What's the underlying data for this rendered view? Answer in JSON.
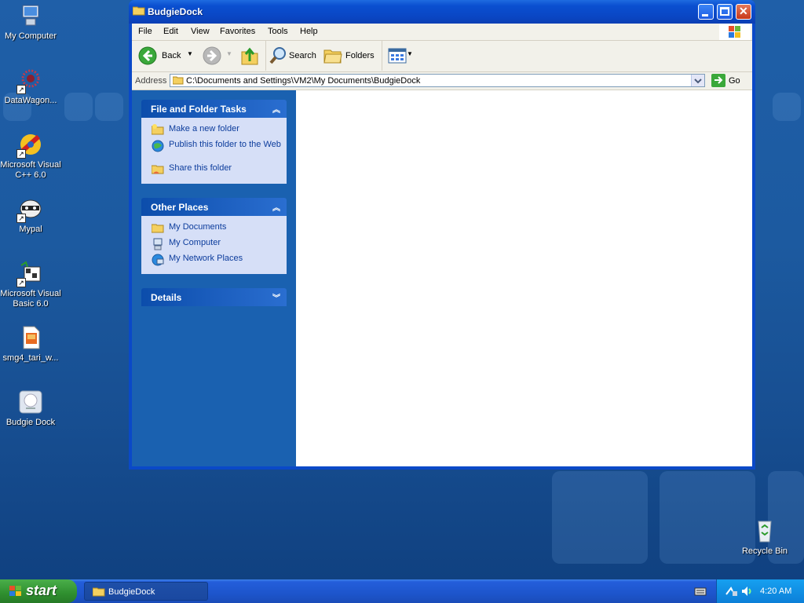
{
  "desktop": {
    "icons": [
      {
        "label": "My Computer"
      },
      {
        "label": "DataWagon..."
      },
      {
        "label": "Microsoft Visual C++ 6.0"
      },
      {
        "label": "Mypal"
      },
      {
        "label": "Microsoft Visual Basic 6.0"
      },
      {
        "label": "smg4_tari_w..."
      },
      {
        "label": "Budgie Dock"
      },
      {
        "label": "Recycle Bin"
      }
    ]
  },
  "window": {
    "title": "BudgieDock",
    "menu": [
      "File",
      "Edit",
      "View",
      "Favorites",
      "Tools",
      "Help"
    ],
    "toolbar": {
      "back": "Back",
      "search": "Search",
      "folders": "Folders"
    },
    "address": {
      "label": "Address",
      "value": "C:\\Documents and Settings\\VM2\\My Documents\\BudgieDock",
      "go": "Go"
    },
    "tasks": {
      "title": "File and Folder Tasks",
      "items": [
        "Make a new folder",
        "Publish this folder to the Web",
        "Share this folder"
      ]
    },
    "places": {
      "title": "Other Places",
      "items": [
        "My Documents",
        "My Computer",
        "My Network Places"
      ]
    },
    "details": {
      "title": "Details"
    }
  },
  "taskbar": {
    "start": "start",
    "tasks": [
      "BudgieDock"
    ],
    "clock": "4:20 AM"
  }
}
